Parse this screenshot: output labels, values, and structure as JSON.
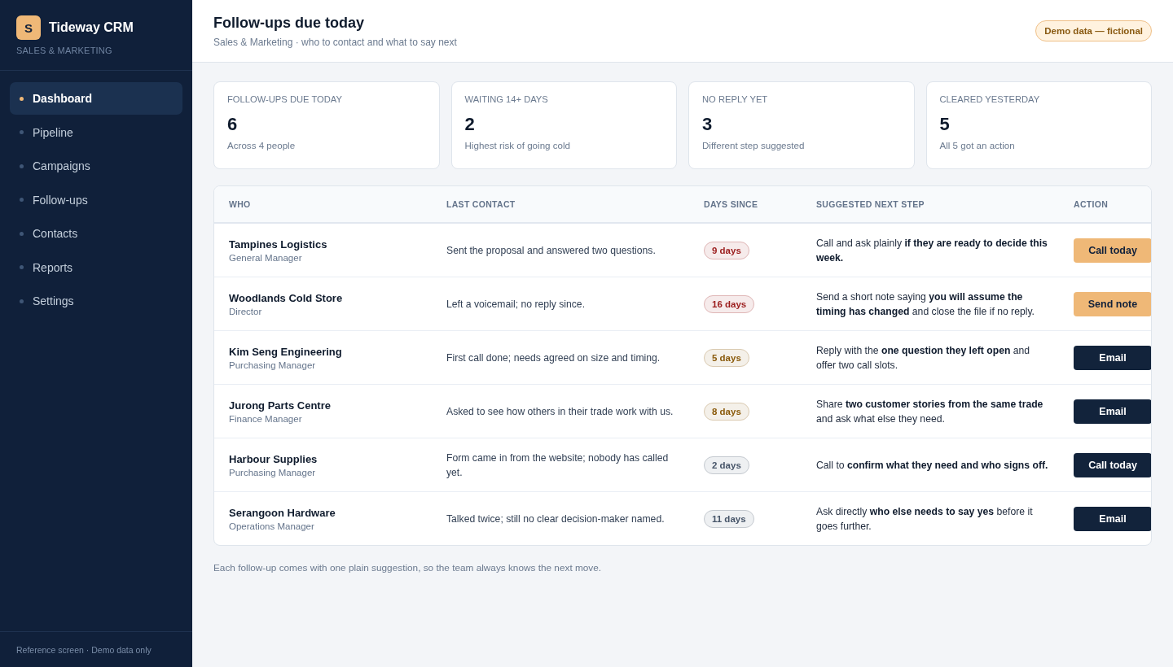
{
  "sidebar": {
    "logo": "S",
    "brand": "Tideway CRM",
    "subtitle": "SALES & MARKETING",
    "items": [
      {
        "label": "Dashboard",
        "selected": true
      },
      {
        "label": "Pipeline",
        "selected": false
      },
      {
        "label": "Campaigns",
        "selected": false
      },
      {
        "label": "Follow-ups",
        "selected": false
      },
      {
        "label": "Contacts",
        "selected": false
      },
      {
        "label": "Reports",
        "selected": false
      },
      {
        "label": "Settings",
        "selected": false
      }
    ],
    "footer": "Reference screen · Demo data only"
  },
  "header": {
    "title": "Follow-ups due today",
    "subtitle": "Sales & Marketing · who to contact and what to say next",
    "badge": "Demo data — fictional"
  },
  "stats": [
    {
      "label": "FOLLOW-UPS DUE TODAY",
      "value": "6",
      "note": "Across 4 people"
    },
    {
      "label": "WAITING 14+ DAYS",
      "value": "2",
      "note": "Highest risk of going cold"
    },
    {
      "label": "NO REPLY YET",
      "value": "3",
      "note": "Different step suggested"
    },
    {
      "label": "CLEARED YESTERDAY",
      "value": "5",
      "note": "All 5 got an action"
    }
  ],
  "table": {
    "columns": [
      "WHO",
      "LAST CONTACT",
      "DAYS SINCE",
      "SUGGESTED NEXT STEP",
      "ACTION"
    ],
    "rows": [
      {
        "name": "Tampines Logistics",
        "role": "General Manager",
        "last_contact": "Sent the proposal and answered two questions.",
        "days": "9 days",
        "color": "#9b1c1c",
        "next_step": "Call and ask plainly **if they are ready to decide this week.**",
        "action": {
          "label": "Call today",
          "kind": "accent"
        }
      },
      {
        "name": "Woodlands Cold Store",
        "role": "Director",
        "last_contact": "Left a voicemail; no reply since.",
        "days": "16 days",
        "color": "#9b1c1c",
        "next_step": "Send a short note saying **you will assume the timing has changed** and close the file if no reply.",
        "action": {
          "label": "Send note",
          "kind": "accent"
        }
      },
      {
        "name": "Kim Seng Engineering",
        "role": "Purchasing Manager",
        "last_contact": "First call done; needs agreed on size and timing.",
        "days": "5 days",
        "color": "#8a5a0b",
        "next_step": "Reply with the **one question they left open** and offer two call slots.",
        "action": {
          "label": "Email",
          "kind": "dark"
        }
      },
      {
        "name": "Jurong Parts Centre",
        "role": "Finance Manager",
        "last_contact": "Asked to see how others in their trade work with us.",
        "days": "8 days",
        "color": "#8a5a0b",
        "next_step": "Share **two customer stories from the same trade** and ask what else they need.",
        "action": {
          "label": "Email",
          "kind": "dark"
        }
      },
      {
        "name": "Harbour Supplies",
        "role": "Purchasing Manager",
        "last_contact": "Form came in from the website; nobody has called yet.",
        "days": "2 days",
        "color": "#475569",
        "next_step": "Call to **confirm what they need and who signs off.**",
        "action": {
          "label": "Call today",
          "kind": "dark"
        }
      },
      {
        "name": "Serangoon Hardware",
        "role": "Operations Manager",
        "last_contact": "Talked twice; still no clear decision-maker named.",
        "days": "11 days",
        "color": "#475569",
        "next_step": "Ask directly **who else needs to say yes** before it goes further.",
        "action": {
          "label": "Email",
          "kind": "dark"
        }
      }
    ]
  },
  "footnote": "Each follow-up comes with one plain suggestion, so the team always knows the next move."
}
